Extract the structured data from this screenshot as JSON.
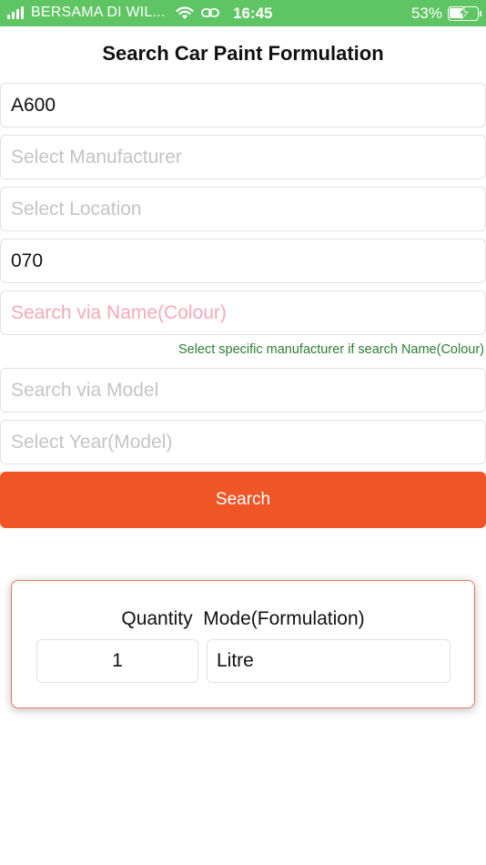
{
  "status_bar": {
    "carrier": "BERSAMA DI WIL...",
    "time": "16:45",
    "battery_percent_text": "53%",
    "battery_level": 0.53,
    "icons": [
      "signal-icon",
      "wifi-icon",
      "link-icon",
      "battery-charging-icon"
    ]
  },
  "page": {
    "title": "Search Car Paint Formulation"
  },
  "form": {
    "code_value": "A600",
    "manufacturer_placeholder": "Select Manufacturer",
    "location_placeholder": "Select Location",
    "number_value": "070",
    "name_colour_placeholder": "Search via Name(Colour)",
    "hint": "Select specific manufacturer if search Name(Colour)",
    "model_placeholder": "Search via Model",
    "year_placeholder": "Select Year(Model)",
    "search_label": "Search"
  },
  "quantity": {
    "title": "Quantity  Mode(Formulation)",
    "quantity_value": "1",
    "mode_value": "Litre"
  },
  "colors": {
    "status_bar": "#5fc463",
    "search_button": "#ee5627",
    "hint_text": "#2e7d32",
    "card_border": "#e07a5f"
  }
}
